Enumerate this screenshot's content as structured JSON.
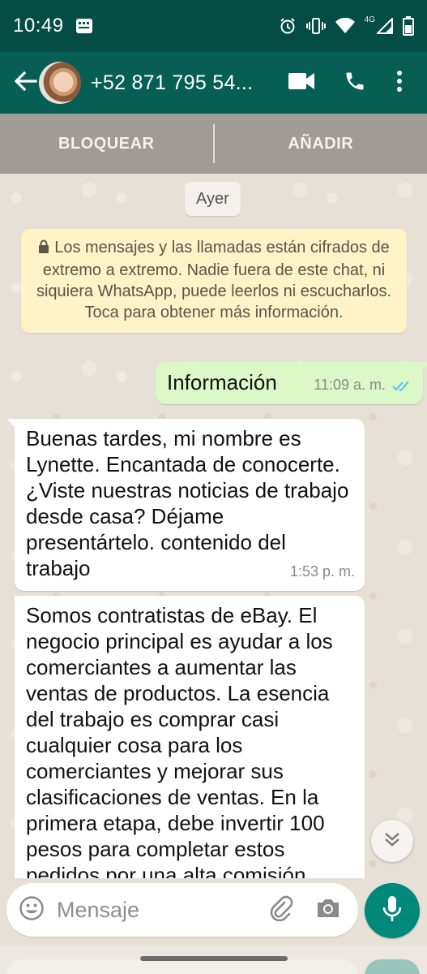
{
  "status_bar": {
    "time": "10:49",
    "network": "4G",
    "icons": [
      "app-notification-icon",
      "alarm-icon",
      "vibrate-icon",
      "wifi-icon",
      "signal-icon",
      "battery-icon"
    ]
  },
  "header": {
    "contact_name": "+52 871 795 54...",
    "icons": [
      "back-arrow-icon",
      "video-call-icon",
      "phone-icon",
      "more-vert-icon"
    ]
  },
  "actions": {
    "block_label": "BLOQUEAR",
    "add_label": "AÑADIR"
  },
  "chat": {
    "date_chip": "Ayer",
    "encryption_notice": "Los mensajes y las llamadas están cifrados de extremo a extremo. Nadie fuera de este chat, ni siquiera WhatsApp, puede leerlos ni escucharlos. Toca para obtener más información.",
    "messages": [
      {
        "direction": "outgoing",
        "text": "Información",
        "time": "11:09 a. m.",
        "status": "read"
      },
      {
        "direction": "incoming",
        "text": "Buenas tardes, mi nombre es Lynette. Encantada de conocerte. ¿Viste nuestras noticias de trabajo desde casa? Déjame presentártelo. contenido del trabajo",
        "time": "1:53 p. m."
      },
      {
        "direction": "incoming",
        "text": "Somos contratistas de eBay. El negocio principal es ayudar a los comerciantes a aumentar las ventas de productos. La esencia del trabajo es comprar casi cualquier cosa para los comerciantes y mejorar sus clasificaciones de ventas. En la primera etapa, debe invertir 100 pesos para completar estos pedidos por una alta comisión"
      }
    ]
  },
  "composer": {
    "placeholder": "Mensaje"
  },
  "colors": {
    "header": "#075e54",
    "status_bar": "#054d44",
    "outgoing_bubble": "#dcf8c6",
    "incoming_bubble": "#ffffff",
    "notice": "#fdf3c7",
    "accent": "#00897b",
    "read_ticks": "#4fc3f7"
  }
}
